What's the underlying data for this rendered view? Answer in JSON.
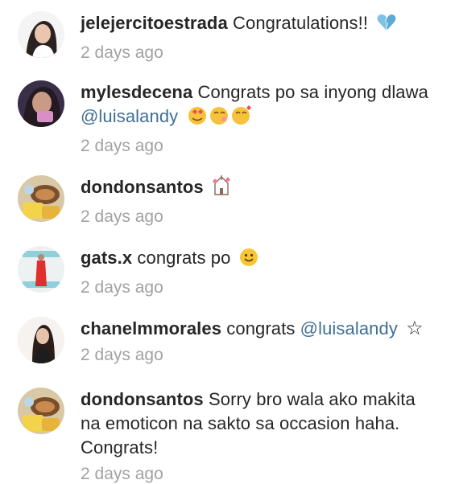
{
  "comments": [
    {
      "user": "jelejercitoestrada",
      "text": "Congratulations!!",
      "time": "2 days ago",
      "emoji": "broken-heart-icon"
    },
    {
      "user": "mylesdecena",
      "text": "Congrats po sa inyong dlawa",
      "mention": "@luisalandy",
      "time": "2 days ago",
      "emoji": "heart-eyes-cats-icon"
    },
    {
      "user": "dondonsantos",
      "text": "",
      "time": "2 days ago",
      "emoji": "wedding-chapel-icon"
    },
    {
      "user": "gats.x",
      "text": "congrats po",
      "time": "2 days ago",
      "emoji": "smiley-face-icon"
    },
    {
      "user": "chanelmmorales",
      "text": "congrats",
      "mention": "@luisalandy",
      "time": "2 days ago",
      "emoji": "star-icon"
    },
    {
      "user": "dondonsantos",
      "text_line1": "Sorry bro wala ako makita",
      "text_line2": "na emoticon na sakto sa occasion haha.",
      "text_line3": "Congrats!",
      "time": "2 days ago"
    }
  ],
  "colors": {
    "username": "#262626",
    "mention": "#3f6f95",
    "timestamp": "#a2a2a2",
    "background": "#ffffff"
  }
}
